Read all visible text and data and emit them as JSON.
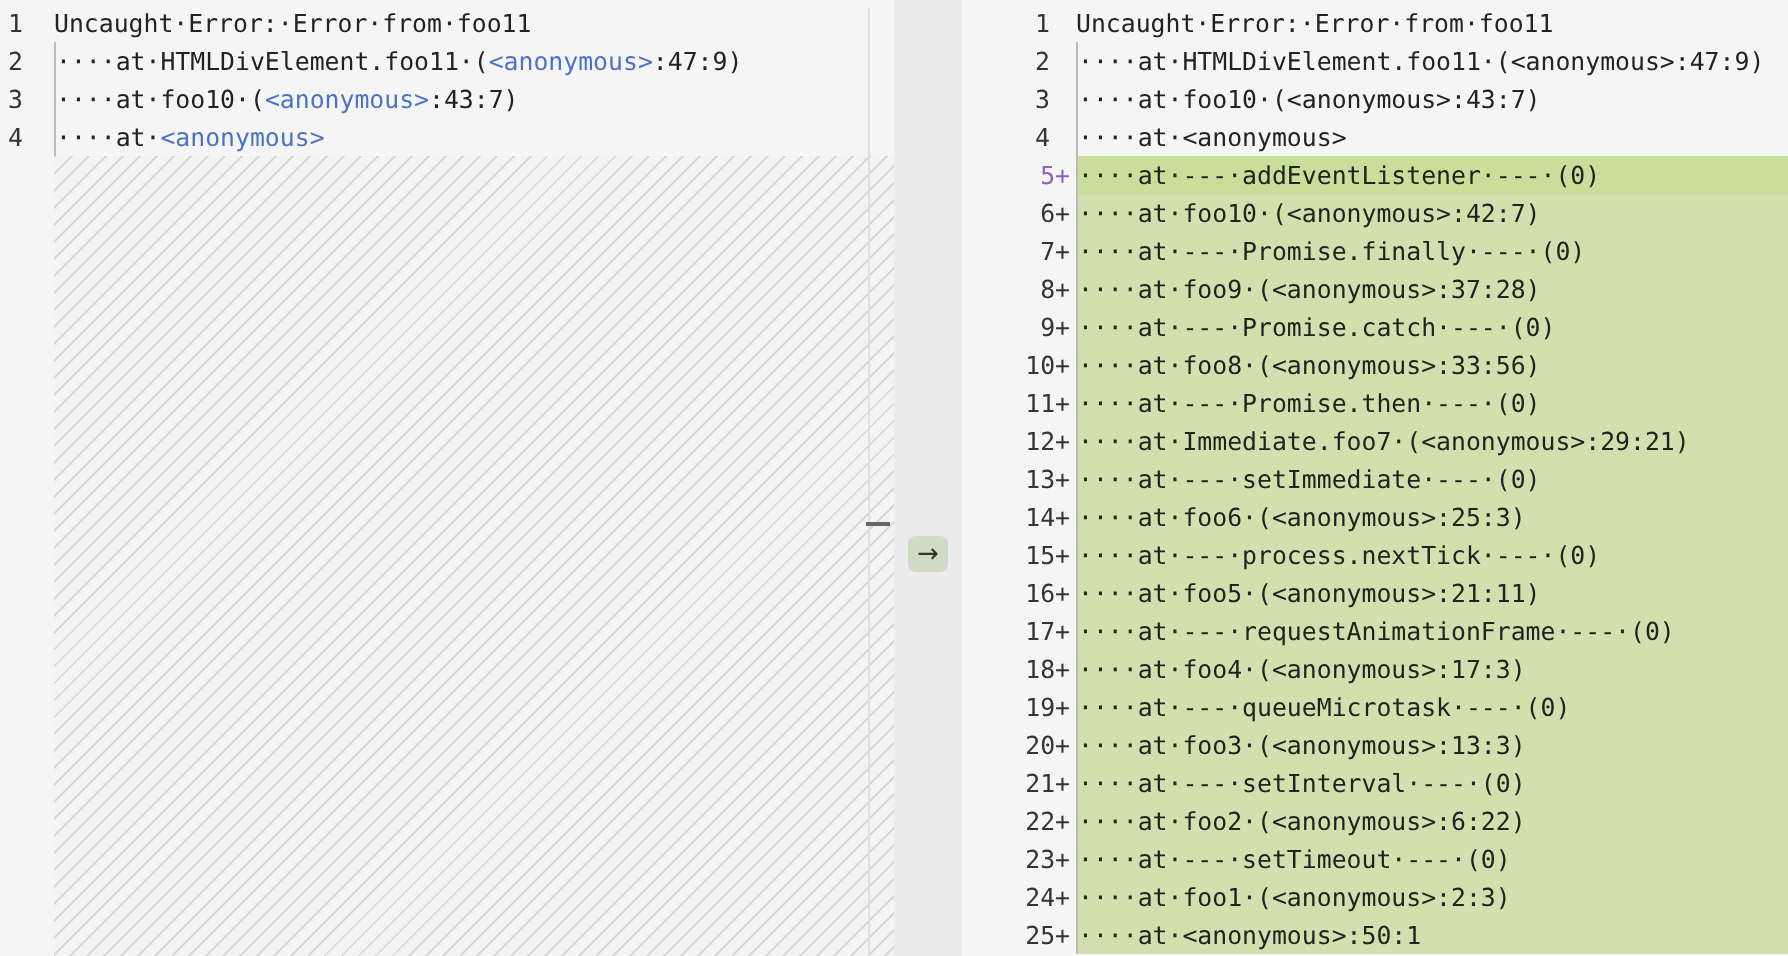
{
  "left_pane": {
    "lines": [
      {
        "number": "1",
        "segments": [
          {
            "kind": "plain",
            "text": "Uncaught·Error:·Error·from·foo11"
          }
        ]
      },
      {
        "number": "2",
        "segments": [
          {
            "kind": "plain",
            "text": "····at·HTMLDivElement.foo11·("
          },
          {
            "kind": "link",
            "text": "<anonymous>"
          },
          {
            "kind": "plain",
            "text": ":47:9)"
          }
        ]
      },
      {
        "number": "3",
        "segments": [
          {
            "kind": "plain",
            "text": "····at·foo10·("
          },
          {
            "kind": "link",
            "text": "<anonymous>"
          },
          {
            "kind": "plain",
            "text": ":43:7)"
          }
        ]
      },
      {
        "number": "4",
        "segments": [
          {
            "kind": "plain",
            "text": "····at·"
          },
          {
            "kind": "link",
            "text": "<anonymous>"
          }
        ]
      }
    ]
  },
  "merge_button": {
    "label": "→"
  },
  "right_pane": {
    "lines": [
      {
        "number": "1",
        "added": false,
        "current": false,
        "text": "Uncaught·Error:·Error·from·foo11"
      },
      {
        "number": "2",
        "added": false,
        "current": false,
        "text": "····at·HTMLDivElement.foo11·(<anonymous>:47:9)"
      },
      {
        "number": "3",
        "added": false,
        "current": false,
        "text": "····at·foo10·(<anonymous>:43:7)"
      },
      {
        "number": "4",
        "added": false,
        "current": false,
        "text": "····at·<anonymous>"
      },
      {
        "number": "5",
        "marker": "+",
        "added": true,
        "current": true,
        "text": "····at·---·addEventListener·---·(0)"
      },
      {
        "number": "6",
        "marker": "+",
        "added": true,
        "current": false,
        "text": "····at·foo10·(<anonymous>:42:7)"
      },
      {
        "number": "7",
        "marker": "+",
        "added": true,
        "current": false,
        "text": "····at·---·Promise.finally·---·(0)"
      },
      {
        "number": "8",
        "marker": "+",
        "added": true,
        "current": false,
        "text": "····at·foo9·(<anonymous>:37:28)"
      },
      {
        "number": "9",
        "marker": "+",
        "added": true,
        "current": false,
        "text": "····at·---·Promise.catch·---·(0)"
      },
      {
        "number": "10",
        "marker": "+",
        "added": true,
        "current": false,
        "text": "····at·foo8·(<anonymous>:33:56)"
      },
      {
        "number": "11",
        "marker": "+",
        "added": true,
        "current": false,
        "text": "····at·---·Promise.then·---·(0)"
      },
      {
        "number": "12",
        "marker": "+",
        "added": true,
        "current": false,
        "text": "····at·Immediate.foo7·(<anonymous>:29:21)"
      },
      {
        "number": "13",
        "marker": "+",
        "added": true,
        "current": false,
        "text": "····at·---·setImmediate·---·(0)"
      },
      {
        "number": "14",
        "marker": "+",
        "added": true,
        "current": false,
        "text": "····at·foo6·(<anonymous>:25:3)"
      },
      {
        "number": "15",
        "marker": "+",
        "added": true,
        "current": false,
        "text": "····at·---·process.nextTick·---·(0)"
      },
      {
        "number": "16",
        "marker": "+",
        "added": true,
        "current": false,
        "text": "····at·foo5·(<anonymous>:21:11)"
      },
      {
        "number": "17",
        "marker": "+",
        "added": true,
        "current": false,
        "text": "····at·---·requestAnimationFrame·---·(0)"
      },
      {
        "number": "18",
        "marker": "+",
        "added": true,
        "current": false,
        "text": "····at·foo4·(<anonymous>:17:3)"
      },
      {
        "number": "19",
        "marker": "+",
        "added": true,
        "current": false,
        "text": "····at·---·queueMicrotask·---·(0)"
      },
      {
        "number": "20",
        "marker": "+",
        "added": true,
        "current": false,
        "text": "····at·foo3·(<anonymous>:13:3)"
      },
      {
        "number": "21",
        "marker": "+",
        "added": true,
        "current": false,
        "text": "····at·---·setInterval·---·(0)"
      },
      {
        "number": "22",
        "marker": "+",
        "added": true,
        "current": false,
        "text": "····at·foo2·(<anonymous>:6:22)"
      },
      {
        "number": "23",
        "marker": "+",
        "added": true,
        "current": false,
        "text": "····at·---·setTimeout·---·(0)"
      },
      {
        "number": "24",
        "marker": "+",
        "added": true,
        "current": false,
        "text": "····at·foo1·(<anonymous>:2:3)"
      },
      {
        "number": "25",
        "marker": "+",
        "added": true,
        "current": false,
        "text": "····at·<anonymous>:50:1"
      }
    ]
  }
}
